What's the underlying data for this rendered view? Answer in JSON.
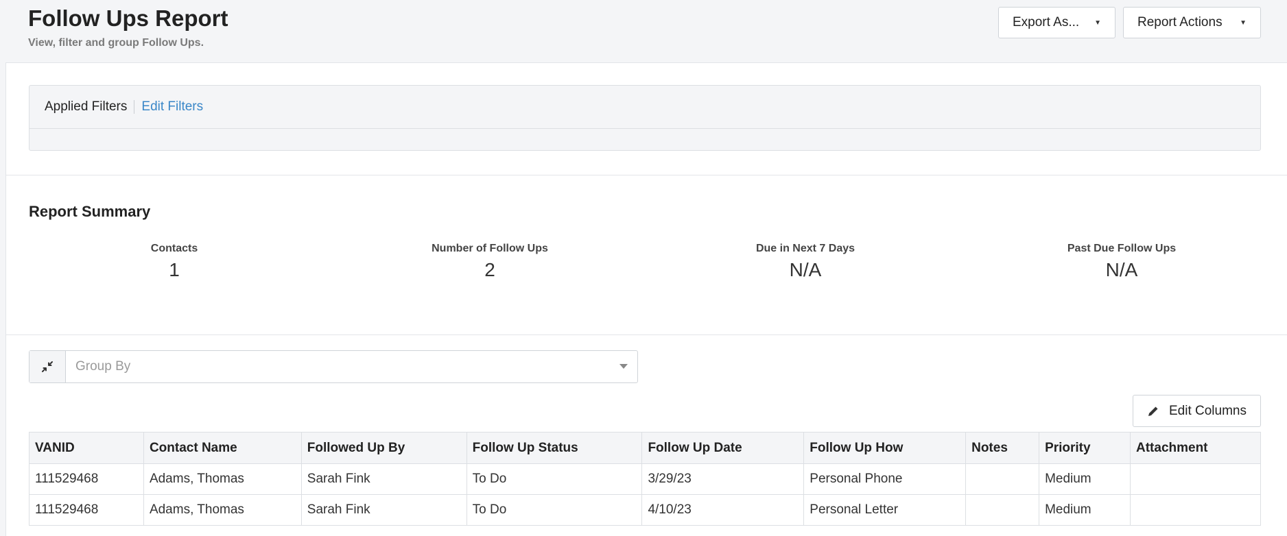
{
  "header": {
    "title": "Follow Ups Report",
    "subtitle": "View, filter and group Follow Ups.",
    "export_label": "Export As...",
    "actions_label": "Report Actions"
  },
  "filters": {
    "label": "Applied Filters",
    "edit_label": "Edit Filters"
  },
  "summary": {
    "title": "Report Summary",
    "stats": [
      {
        "label": "Contacts",
        "value": "1"
      },
      {
        "label": "Number of Follow Ups",
        "value": "2"
      },
      {
        "label": "Due in Next 7 Days",
        "value": "N/A"
      },
      {
        "label": "Past Due Follow Ups",
        "value": "N/A"
      }
    ]
  },
  "groupby": {
    "placeholder": "Group By"
  },
  "edit_columns_label": "Edit Columns",
  "table": {
    "columns": [
      "VANID",
      "Contact Name",
      "Followed Up By",
      "Follow Up Status",
      "Follow Up Date",
      "Follow Up How",
      "Notes",
      "Priority",
      "Attachment"
    ],
    "rows": [
      [
        "111529468",
        "Adams, Thomas",
        "Sarah Fink",
        "To Do",
        "3/29/23",
        "Personal Phone",
        "",
        "Medium",
        ""
      ],
      [
        "111529468",
        "Adams, Thomas",
        "Sarah Fink",
        "To Do",
        "4/10/23",
        "Personal Letter",
        "",
        "Medium",
        ""
      ]
    ]
  },
  "colors": {
    "link": "#3a87c8",
    "background": "#f4f5f7"
  }
}
